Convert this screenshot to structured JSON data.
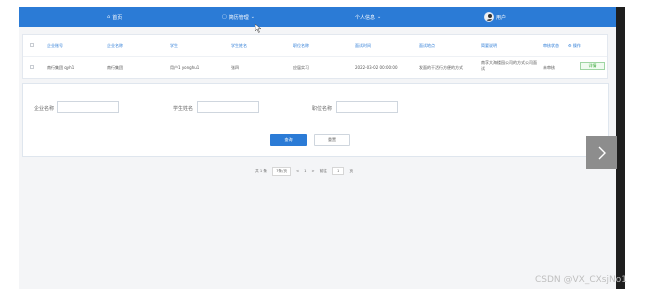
{
  "topbar": {
    "home_label": "首页",
    "menu1_label": "简历管理",
    "menu2_label": "个人信息",
    "user_label": "用户"
  },
  "table": {
    "headers": [
      "企业账号",
      "企业名称",
      "学生",
      "学生姓名",
      "职位名称",
      "面试时间",
      "面试地点",
      "简要说明",
      "审核状态",
      "操作"
    ],
    "row": {
      "cells": [
        "南行集团 qyh1",
        "南行集团",
        "用户1 yonghu1",
        "张四",
        "应届实习",
        "2022-03-02 00:00:00",
        "发面的干活行方便的方式",
        "南孚大海楼园公司的方式公司面试",
        "未审核"
      ],
      "action_tag": "详情"
    }
  },
  "form": {
    "field1_label": "企业名称",
    "field2_label": "学生姓名",
    "field3_label": "职位名称",
    "search_button": "查询",
    "reset_button": "重置"
  },
  "pager": {
    "total": "共 1 条",
    "page_size": "7条/页",
    "prev": "<",
    "current": "1",
    "next": ">",
    "goto_label": "前往",
    "goto_value": "1",
    "page_suffix": "页"
  },
  "watermark": "CSDN @VX_CXsjNo1",
  "colors": {
    "primary": "#2b7bd6",
    "success": "#3aa93a"
  }
}
